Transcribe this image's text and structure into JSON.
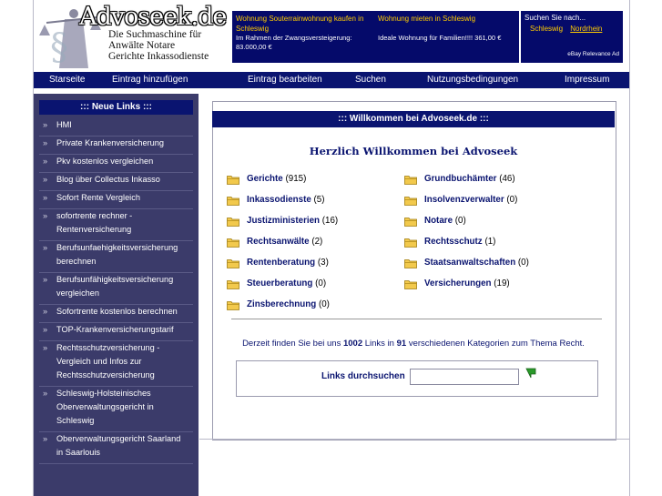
{
  "logo": {
    "title": "Advoseek.de",
    "subtitle_lines": [
      "Die Suchmaschine für",
      "Anwälte    Notare",
      "Gerichte   Inkassodienste"
    ]
  },
  "ads": [
    {
      "title": "Wohnung Souterrainwohnung kaufen in Schleswig",
      "body": "Im Rahmen der Zwangsversteigerung: 83.000,00 €"
    },
    {
      "title": "Wohnung mieten in Schleswig",
      "body": "Ideale Wohnung für Familien!!!! 361,00 €"
    }
  ],
  "search_ad": {
    "title": "Suchen Sie nach...",
    "link1": "Schleswig",
    "link2": "Nordrhein",
    "relevance": "eBay Relevance Ad"
  },
  "nav": [
    "Starseite",
    "Eintrag hinzufügen",
    "Eintrag bearbeiten",
    "Suchen",
    "Nutzungsbedingungen",
    "Impressum"
  ],
  "sidebar": {
    "title": "::: Neue Links :::",
    "items": [
      "HMI",
      "Private Krankenversicherung",
      "Pkv kostenlos vergleichen",
      "Blog über Collectus Inkasso",
      "Sofort Rente Vergleich",
      "sofortrente rechner - Rentenversicherung",
      "Berufsunfaehigkeitsversicherung berechnen",
      "Berufsunfähigkeitsversicherung vergleichen",
      "Sofortrente kostenlos berechnen",
      "TOP-Krankenversicherungstarif",
      "Rechtsschutzversicherung - Vergleich und Infos zur Rechtsschutzversicherung",
      "Schleswig-Holsteinisches Oberverwaltungsgericht in Schleswig",
      "Oberverwaltungsgericht Saarland in Saarlouis"
    ]
  },
  "main": {
    "title": "::: Willkommen bei Advoseek.de :::",
    "welcome": "Herzlich Willkommen bei Advoseek",
    "categories": [
      {
        "name": "Gerichte",
        "count": "(915)"
      },
      {
        "name": "Grundbuchämter",
        "count": "(46)"
      },
      {
        "name": "Inkassodienste",
        "count": "(5)"
      },
      {
        "name": "Insolvenzverwalter",
        "count": "(0)"
      },
      {
        "name": "Justizministerien",
        "count": "(16)"
      },
      {
        "name": "Notare",
        "count": "(0)"
      },
      {
        "name": "Rechtsanwälte",
        "count": "(2)"
      },
      {
        "name": "Rechtsschutz",
        "count": "(1)"
      },
      {
        "name": "Rentenberatung",
        "count": "(3)"
      },
      {
        "name": "Staatsanwaltschaften",
        "count": "(0)"
      },
      {
        "name": "Steuerberatung",
        "count": "(0)"
      },
      {
        "name": "Versicherungen",
        "count": "(19)"
      },
      {
        "name": "Zinsberechnung",
        "count": "(0)"
      }
    ],
    "stats": {
      "prefix": "Derzeit finden Sie bei uns",
      "links": "1002",
      "mid": "Links in",
      "cats": "91",
      "suffix": "verschiedenen Kategorien zum Thema Recht."
    },
    "search_label": "Links durchsuchen",
    "search_value": ""
  },
  "colors": {
    "nav_bg": "#0a1470",
    "sidebar_bg": "#3b3b6a",
    "ad_bg": "#050a6a",
    "ad_title": "#ffcc00",
    "folder": "#f2c94c"
  }
}
